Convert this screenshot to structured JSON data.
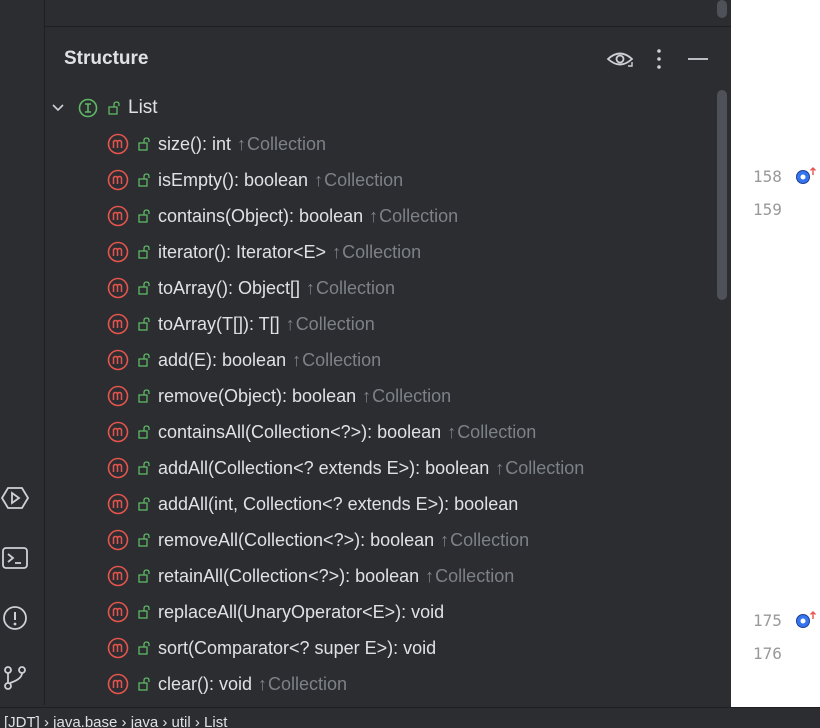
{
  "panel": {
    "title": "Structure"
  },
  "tree": {
    "root": {
      "label": "List",
      "kind": "interface"
    },
    "inherited_prefix": "↑",
    "items": [
      {
        "sig": "size(): int",
        "origin": "Collection"
      },
      {
        "sig": "isEmpty(): boolean",
        "origin": "Collection"
      },
      {
        "sig": "contains(Object): boolean",
        "origin": "Collection"
      },
      {
        "sig": "iterator(): Iterator<E>",
        "origin": "Collection"
      },
      {
        "sig": "toArray(): Object[]",
        "origin": "Collection"
      },
      {
        "sig": "toArray(T[]): T[]",
        "origin": "Collection"
      },
      {
        "sig": "add(E): boolean",
        "origin": "Collection"
      },
      {
        "sig": "remove(Object): boolean",
        "origin": "Collection"
      },
      {
        "sig": "containsAll(Collection<?>): boolean",
        "origin": "Collection"
      },
      {
        "sig": "addAll(Collection<? extends E>): boolean",
        "origin": "Collection"
      },
      {
        "sig": "addAll(int, Collection<? extends E>): boolean",
        "origin": ""
      },
      {
        "sig": "removeAll(Collection<?>): boolean",
        "origin": "Collection"
      },
      {
        "sig": "retainAll(Collection<?>): boolean",
        "origin": "Collection"
      },
      {
        "sig": "replaceAll(UnaryOperator<E>): void",
        "origin": ""
      },
      {
        "sig": "sort(Comparator<? super E>): void",
        "origin": ""
      },
      {
        "sig": "clear(): void",
        "origin": "Collection"
      }
    ]
  },
  "editor": {
    "gutter": [
      {
        "line": "158",
        "marker": true
      },
      {
        "line": "159",
        "marker": false
      },
      {
        "line": "175",
        "marker": true
      },
      {
        "line": "176",
        "marker": false
      }
    ]
  },
  "statusbar": {
    "text": "[JDT] › java.base › java › util › List"
  },
  "colors": {
    "method_icon": "#e5544f",
    "interface_icon": "#5fb865",
    "lock_icon": "#5fb865",
    "background": "#2b2d30",
    "text": "#dfe1e5",
    "muted": "#7d8188",
    "override_marker": "#3574f0"
  }
}
